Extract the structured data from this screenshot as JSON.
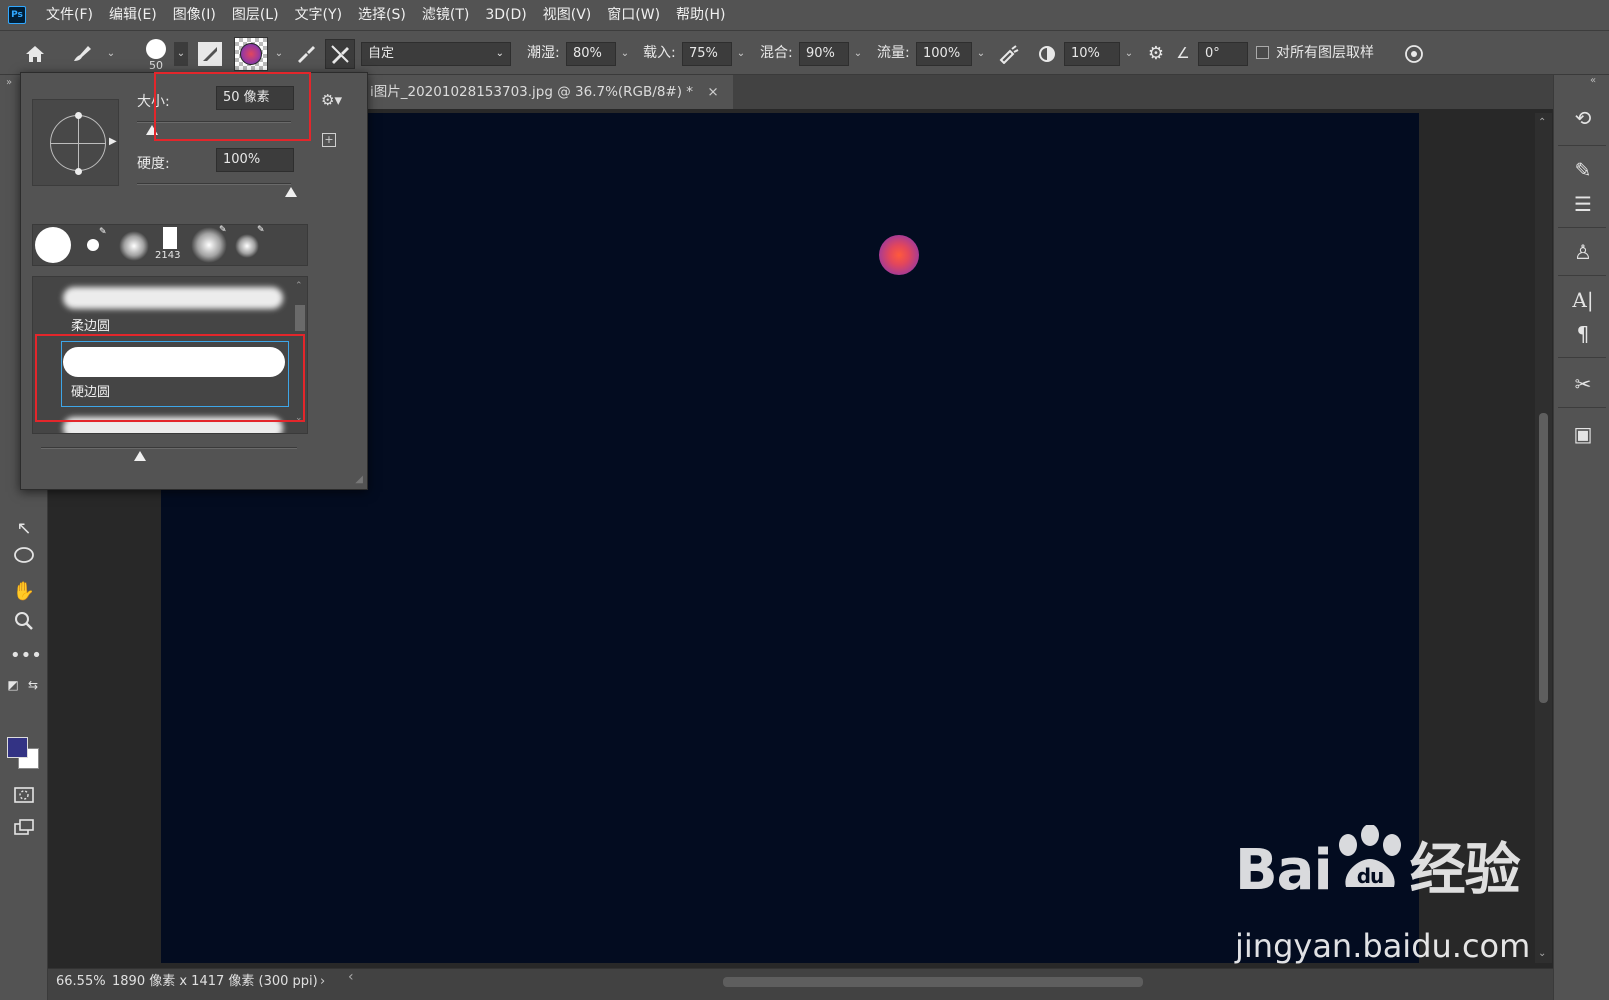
{
  "menubar": {
    "logo": "Ps",
    "items": [
      "文件(F)",
      "编辑(E)",
      "图像(I)",
      "图层(L)",
      "文字(Y)",
      "选择(S)",
      "滤镜(T)",
      "3D(D)",
      "视图(V)",
      "窗口(W)",
      "帮助(H)"
    ]
  },
  "options": {
    "brush_size": "50",
    "mode": "自定",
    "wet_label": "潮湿:",
    "wet_value": "80%",
    "load_label": "载入:",
    "load_value": "75%",
    "mix_label": "混合:",
    "mix_value": "90%",
    "flow_label": "流量:",
    "flow_value": "100%",
    "smoothing_value": "10%",
    "angle_value": "0°",
    "sample_all_label": "对所有图层取样",
    "sample_all_checked": false
  },
  "document": {
    "tab_title": "i图片_20201028153703.jpg @ 36.7%(RGB/8#) *",
    "tab_close": "×",
    "canvas_color": "#030c20",
    "zoom": "66.55%",
    "doc_info": "1890 像素 x 1417 像素 (300 ppi)",
    "status_arrow": "›",
    "scroll_left": "‹"
  },
  "brush_popup": {
    "size_label": "大小:",
    "size_value": "50 像素",
    "size_fraction": 0.1,
    "hardness_label": "硬度:",
    "hardness_value": "100%",
    "hardness_fraction": 1.0,
    "recent_size_label": "2143",
    "presets": [
      {
        "name": "柔边圆"
      },
      {
        "name": "硬边圆"
      }
    ],
    "selected_preset": "硬边圆"
  },
  "colors": {
    "foreground": "#333384",
    "background": "#ffffff",
    "accent_selection": "#3ea6e8",
    "annotation_red": "#e3262b"
  },
  "watermark": {
    "brand": "Bai",
    "brand_cn": "经验",
    "url": "jingyan.baidu.com"
  }
}
